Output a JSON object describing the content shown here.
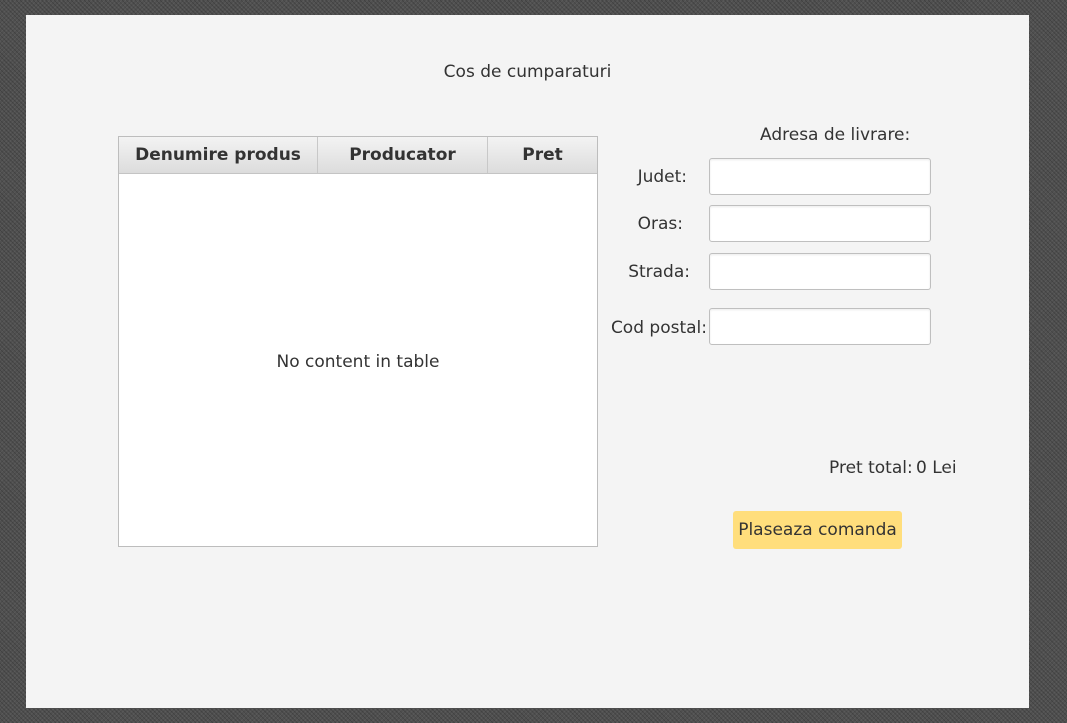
{
  "window": {
    "title": "Cos de cumparaturi"
  },
  "table": {
    "columns": [
      "Denumire produs",
      "Producator",
      "Pret"
    ],
    "rows": [],
    "placeholder": "No content in table"
  },
  "address": {
    "title": "Adresa de livrare:",
    "fields": [
      {
        "label": "Judet:",
        "value": ""
      },
      {
        "label": "Oras:",
        "value": ""
      },
      {
        "label": "Strada:",
        "value": ""
      },
      {
        "label": "Cod postal:",
        "value": ""
      }
    ]
  },
  "total": {
    "label": "Pret total:",
    "value": "0 Lei"
  },
  "actions": {
    "order_label": "Plaseaza comanda"
  },
  "colors": {
    "background": "#f4f4f4",
    "button": "#ffde7c",
    "text": "#333333"
  }
}
